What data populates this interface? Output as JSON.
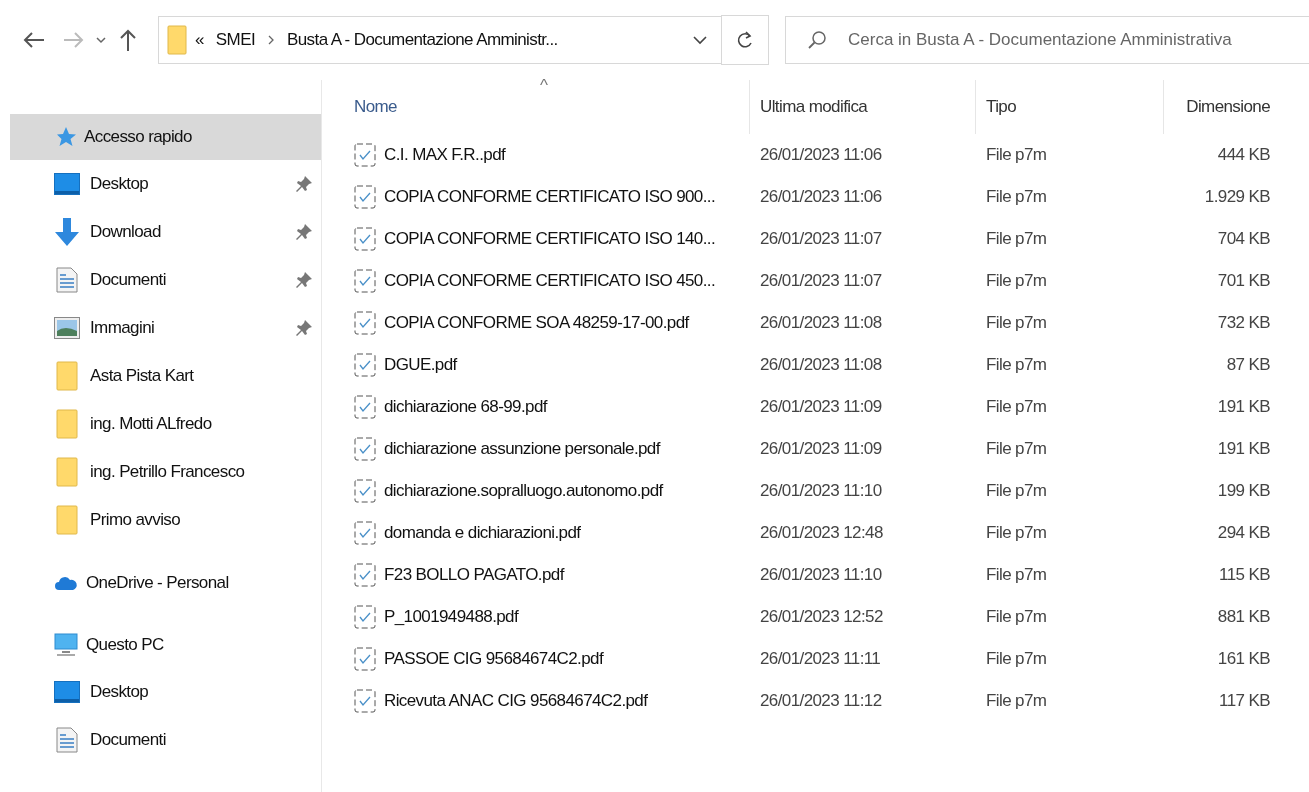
{
  "address_bar": {
    "overflow": "«",
    "path": [
      "SMEI",
      "Busta A - Documentazione Amministr..."
    ]
  },
  "search": {
    "placeholder": "Cerca in Busta A - Documentazione Amministrativa"
  },
  "sidebar": {
    "sections": [
      {
        "label": "Accesso rapido",
        "kind": "star",
        "selected": true,
        "items": [
          {
            "label": "Desktop",
            "kind": "desktop",
            "pinned": true
          },
          {
            "label": "Download",
            "kind": "download",
            "pinned": true
          },
          {
            "label": "Documenti",
            "kind": "document",
            "pinned": true
          },
          {
            "label": "Immagini",
            "kind": "image",
            "pinned": true
          },
          {
            "label": "Asta Pista Kart",
            "kind": "folder",
            "pinned": false
          },
          {
            "label": "ing. Motti ALfredo",
            "kind": "folder",
            "pinned": false
          },
          {
            "label": "ing. Petrillo Francesco",
            "kind": "folder",
            "pinned": false
          },
          {
            "label": "Primo avviso",
            "kind": "folder",
            "pinned": false
          }
        ]
      },
      {
        "label": "OneDrive - Personal",
        "kind": "cloud",
        "selected": false
      },
      {
        "label": "Questo PC",
        "kind": "pc",
        "selected": false,
        "items": [
          {
            "label": "Desktop",
            "kind": "desktop",
            "pinned": false
          },
          {
            "label": "Documenti",
            "kind": "document",
            "pinned": false
          }
        ]
      }
    ]
  },
  "table": {
    "sort_indicator": "^",
    "columns": [
      "Nome",
      "Ultima modifica",
      "Tipo",
      "Dimensione"
    ],
    "rows": [
      {
        "name": "C.I. MAX F.R..pdf",
        "modified": "26/01/2023 11:06",
        "type": "File p7m",
        "size": "444 KB"
      },
      {
        "name": "COPIA CONFORME CERTIFICATO ISO 900...",
        "modified": "26/01/2023 11:06",
        "type": "File p7m",
        "size": "1.929 KB"
      },
      {
        "name": "COPIA CONFORME CERTIFICATO ISO 140...",
        "modified": "26/01/2023 11:07",
        "type": "File p7m",
        "size": "704 KB"
      },
      {
        "name": "COPIA CONFORME CERTIFICATO ISO 450...",
        "modified": "26/01/2023 11:07",
        "type": "File p7m",
        "size": "701 KB"
      },
      {
        "name": "COPIA CONFORME SOA 48259-17-00.pdf",
        "modified": "26/01/2023 11:08",
        "type": "File p7m",
        "size": "732 KB"
      },
      {
        "name": "DGUE.pdf",
        "modified": "26/01/2023 11:08",
        "type": "File p7m",
        "size": "87 KB"
      },
      {
        "name": "dichiarazione 68-99.pdf",
        "modified": "26/01/2023 11:09",
        "type": "File p7m",
        "size": "191 KB"
      },
      {
        "name": "dichiarazione assunzione personale.pdf",
        "modified": "26/01/2023 11:09",
        "type": "File p7m",
        "size": "191 KB"
      },
      {
        "name": "dichiarazione.sopralluogo.autonomo.pdf",
        "modified": "26/01/2023 11:10",
        "type": "File p7m",
        "size": "199 KB"
      },
      {
        "name": "domanda e dichiarazioni.pdf",
        "modified": "26/01/2023 12:48",
        "type": "File p7m",
        "size": "294 KB"
      },
      {
        "name": "F23 BOLLO PAGATO.pdf",
        "modified": "26/01/2023 11:10",
        "type": "File p7m",
        "size": "115 KB"
      },
      {
        "name": "P_1001949488.pdf",
        "modified": "26/01/2023 12:52",
        "type": "File p7m",
        "size": "881 KB"
      },
      {
        "name": "PASSOE CIG 95684674C2.pdf",
        "modified": "26/01/2023 11:11",
        "type": "File p7m",
        "size": "161 KB"
      },
      {
        "name": "Ricevuta ANAC CIG 95684674C2.pdf",
        "modified": "26/01/2023 11:12",
        "type": "File p7m",
        "size": "117 KB"
      }
    ]
  }
}
